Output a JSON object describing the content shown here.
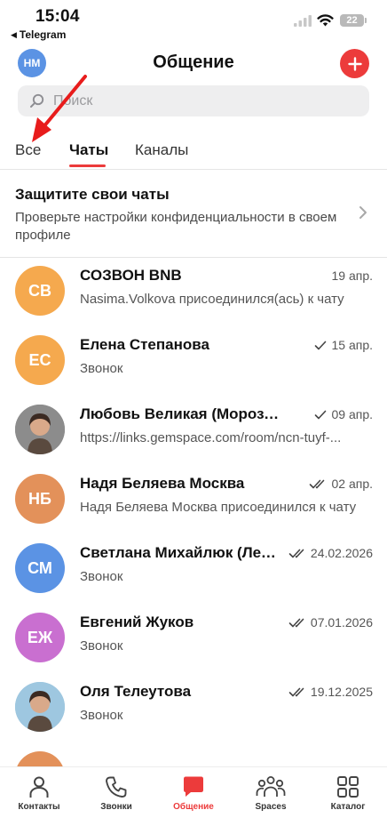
{
  "status_bar": {
    "time": "15:04",
    "back_app": "Telegram",
    "battery": "22"
  },
  "header": {
    "avatar_initials": "НМ",
    "title": "Общение",
    "compose_icon": "plus-icon",
    "accent_color": "#ec3b3b"
  },
  "search": {
    "placeholder": "Поиск"
  },
  "tabs": [
    {
      "label": "Все",
      "active": false
    },
    {
      "label": "Чаты",
      "active": true
    },
    {
      "label": "Каналы",
      "active": false
    }
  ],
  "banner": {
    "title": "Защитите свои чаты",
    "text": "Проверьте настройки конфиденциальности в своем профиле"
  },
  "chats": [
    {
      "initials": "СВ",
      "avatar_color": "#f5a94e",
      "name": "СОЗВОН BNB",
      "date": "19 апр.",
      "read": "none",
      "preview": "Nasima.Volkova присоединился(ась) к чату"
    },
    {
      "initials": "ЕС",
      "avatar_color": "#f5a94e",
      "name": "Елена Степанова",
      "date": "15 апр.",
      "read": "single",
      "preview": "Звонок"
    },
    {
      "initials": "",
      "avatar_color": "#8c8c8c",
      "photo": true,
      "name": "Любовь Великая (Морозова)",
      "date": "09 апр.",
      "read": "single",
      "preview": "https://links.gemspace.com/room/ncn-tuyf-..."
    },
    {
      "initials": "НБ",
      "avatar_color": "#e3915a",
      "name": "Надя Беляева Москва",
      "date": "02 апр.",
      "read": "double",
      "preview": "Надя Беляева Москва присоединился к чату"
    },
    {
      "initials": "СМ",
      "avatar_color": "#5b93e4",
      "name": "Светлана Михайлюк (Лебедева)",
      "date": "24.02.2026",
      "read": "double",
      "preview": "Звонок"
    },
    {
      "initials": "ЕЖ",
      "avatar_color": "#c96fd0",
      "name": "Евгений Жуков",
      "date": "07.01.2026",
      "read": "double",
      "preview": "Звонок"
    },
    {
      "initials": "",
      "avatar_color": "#9ec7e0",
      "photo": true,
      "name": "Оля Телеутова",
      "date": "19.12.2025",
      "read": "double",
      "preview": "Звонок"
    }
  ],
  "bottom_nav": [
    {
      "label": "Контакты",
      "icon": "person-icon",
      "active": false
    },
    {
      "label": "Звонки",
      "icon": "phone-icon",
      "active": false
    },
    {
      "label": "Общение",
      "icon": "chat-bubble-icon",
      "active": true
    },
    {
      "label": "Spaces",
      "icon": "group-icon",
      "active": false
    },
    {
      "label": "Каталог",
      "icon": "grid-icon",
      "active": false
    }
  ]
}
